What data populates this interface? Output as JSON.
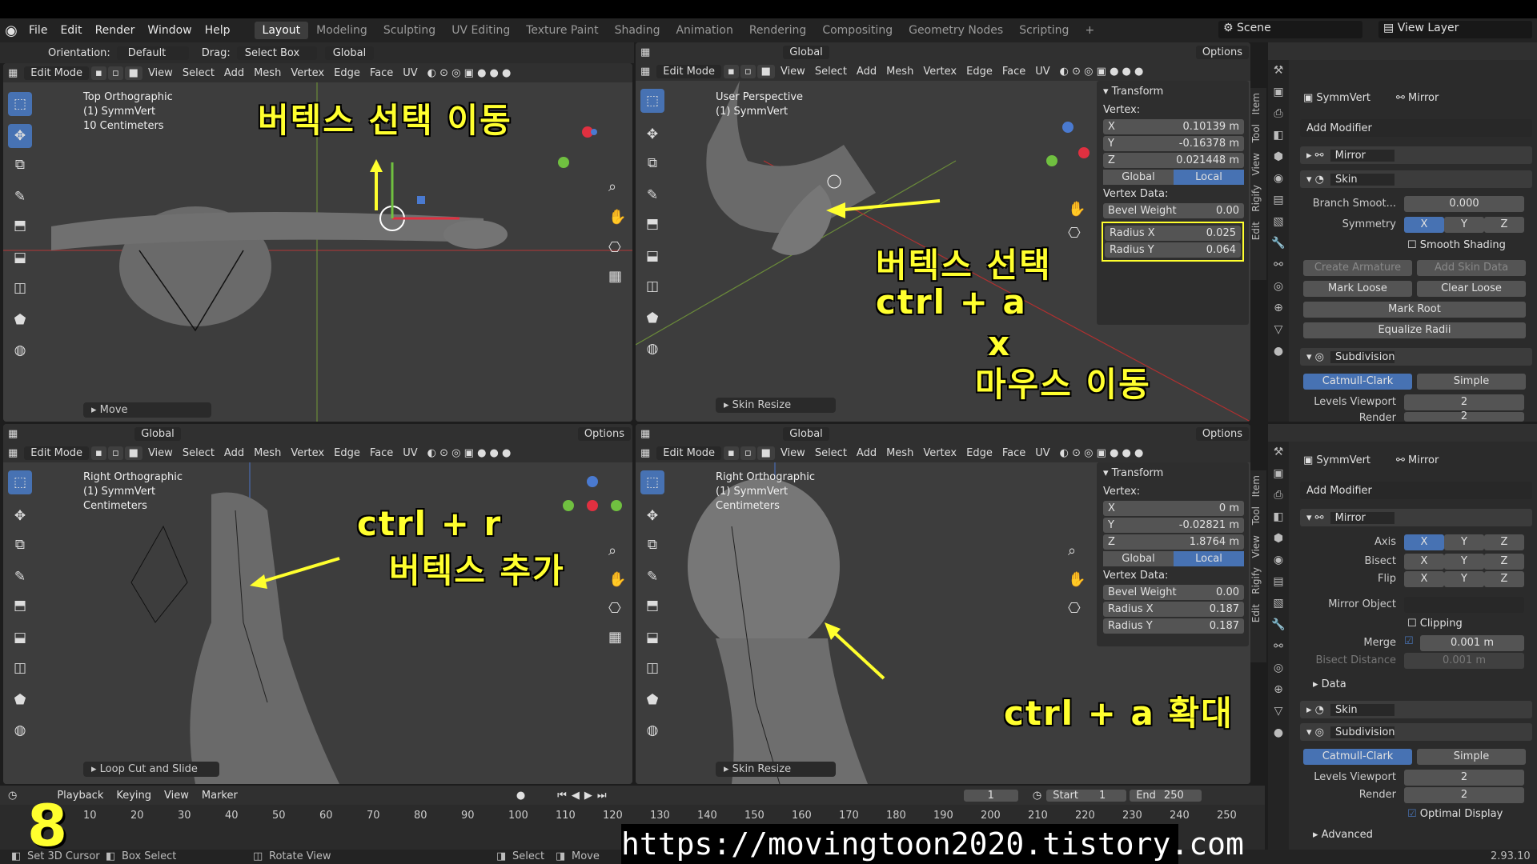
{
  "menu": {
    "items": [
      "File",
      "Edit",
      "Render",
      "Window",
      "Help"
    ]
  },
  "workspaces": [
    "Layout",
    "Modeling",
    "Sculpting",
    "UV Editing",
    "Texture Paint",
    "Shading",
    "Animation",
    "Rendering",
    "Compositing",
    "Geometry Nodes",
    "Scripting"
  ],
  "scene": "Scene",
  "view_layer": "View Layer",
  "toolsettings": {
    "orientation_label": "Orientation:",
    "orientation": "Default",
    "drag_label": "Drag:",
    "drag": "Select Box",
    "transform": "Global"
  },
  "viewport_header": {
    "mode": "Edit Mode",
    "menus": [
      "View",
      "Select",
      "Add",
      "Mesh",
      "Vertex",
      "Edge",
      "Face",
      "UV"
    ],
    "global": "Global",
    "options": "Options"
  },
  "vp_tl": {
    "title": "Top Orthographic",
    "object": "(1) SymmVert",
    "scale": "10 Centimeters",
    "op": "Move",
    "annot": "버텍스 선택 이동"
  },
  "vp_tr": {
    "title": "User Perspective",
    "object": "(1) SymmVert",
    "op": "Skin Resize",
    "annot1": "버텍스 선택",
    "annot2": "ctrl + a",
    "annot3": "x",
    "annot4": "마우스 이동"
  },
  "vp_bl": {
    "title": "Right Orthographic",
    "object": "(1) SymmVert",
    "scale": "Centimeters",
    "op": "Loop Cut and Slide",
    "annot1": "ctrl + r",
    "annot2": "버텍스 추가"
  },
  "vp_br": {
    "title": "Right Orthographic",
    "object": "(1) SymmVert",
    "scale": "Centimeters",
    "op": "Skin Resize",
    "annot": "ctrl + a 확대"
  },
  "npanel_top": {
    "header": "Transform",
    "vertex": "Vertex:",
    "x": "0.10139 m",
    "y": "-0.16378 m",
    "z": "0.021448 m",
    "global": "Global",
    "local": "Local",
    "vdata": "Vertex Data:",
    "bevel_label": "Bevel Weight",
    "bevel": "0.00",
    "rx_label": "Radius X",
    "rx": "0.025",
    "ry_label": "Radius Y",
    "ry": "0.064"
  },
  "npanel_bot": {
    "header": "Transform",
    "vertex": "Vertex:",
    "x": "0 m",
    "y": "-0.02821 m",
    "z": "1.8764 m",
    "global": "Global",
    "local": "Local",
    "vdata": "Vertex Data:",
    "bevel_label": "Bevel Weight",
    "bevel": "0.00",
    "rx_label": "Radius X",
    "rx": "0.187",
    "ry_label": "Radius Y",
    "ry": "0.187"
  },
  "side_tabs": [
    "Item",
    "Tool",
    "View",
    "Rigify",
    "Edit"
  ],
  "props_top": {
    "object": "SymmVert",
    "modifier": "Mirror",
    "add_modifier": "Add Modifier",
    "m1": "Mirror",
    "m2": "Skin",
    "branch_label": "Branch Smoot...",
    "branch": "0.000",
    "sym_label": "Symmetry",
    "x": "X",
    "y": "Y",
    "z": "Z",
    "smooth": "Smooth Shading",
    "create_arm": "Create Armature",
    "add_skin": "Add Skin Data",
    "mark_loose": "Mark Loose",
    "clear_loose": "Clear Loose",
    "mark_root": "Mark Root",
    "equalize": "Equalize Radii",
    "m3": "Subdivision",
    "catmull": "Catmull-Clark",
    "simple": "Simple",
    "levels_label": "Levels Viewport",
    "levels": "2",
    "render_label": "Render",
    "render": "2"
  },
  "props_bot": {
    "object": "SymmVert",
    "modifier": "Mirror",
    "add_modifier": "Add Modifier",
    "m1": "Mirror",
    "axis_label": "Axis",
    "bisect_label": "Bisect",
    "flip_label": "Flip",
    "x": "X",
    "y": "Y",
    "z": "Z",
    "mirror_obj": "Mirror Object",
    "clipping": "Clipping",
    "merge_label": "Merge",
    "merge": "0.001 m",
    "bisect_dist_label": "Bisect Distance",
    "bisect_dist": "0.001 m",
    "data": "Data",
    "m2": "Skin",
    "m3": "Subdivision",
    "catmull": "Catmull-Clark",
    "simple": "Simple",
    "levels_label": "Levels Viewport",
    "levels": "2",
    "render_label": "Render",
    "render": "2",
    "optimal": "Optimal Display",
    "advanced": "Advanced"
  },
  "timeline": {
    "menus": [
      "Playback",
      "Keying",
      "View",
      "Marker"
    ],
    "frame": "1",
    "start_label": "Start",
    "start": "1",
    "end_label": "End",
    "end": "250",
    "ticks": [
      "10",
      "20",
      "30",
      "40",
      "50",
      "60",
      "70",
      "80",
      "90",
      "100",
      "110",
      "120",
      "130",
      "140",
      "150",
      "160",
      "170",
      "180",
      "190",
      "200",
      "210",
      "220",
      "230",
      "240",
      "250"
    ]
  },
  "status": {
    "a": "Set 3D Cursor",
    "b": "Box Select",
    "c": "Rotate View",
    "d": "Select",
    "e": "Move",
    "version": "2.93.10"
  },
  "big_number": "8",
  "url": "https://movingtoon2020.tistory.com"
}
